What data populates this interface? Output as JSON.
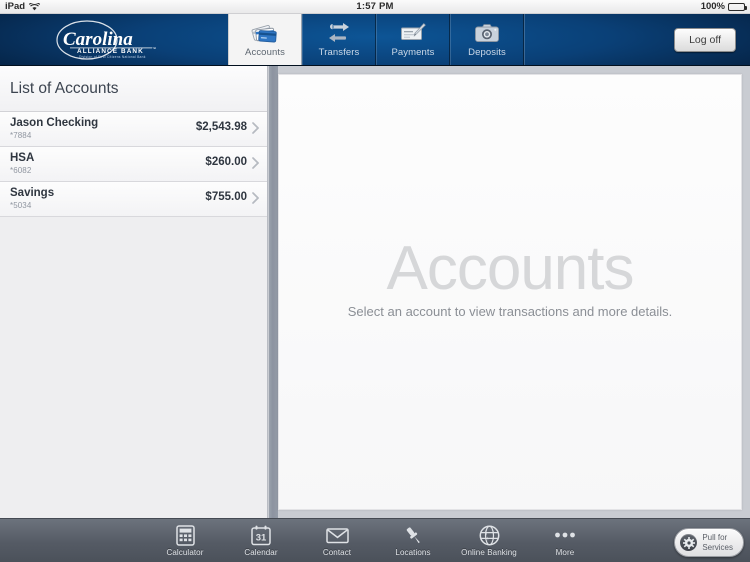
{
  "status_bar": {
    "device": "iPad",
    "wifi_icon": "wifi-icon",
    "time": "1:57 PM",
    "battery_percent": "100%",
    "battery_icon": "battery-full-icon"
  },
  "navbar": {
    "brand": {
      "name": "Carolina",
      "line2": "ALLIANCE BANK",
      "line3": "Division of First Citizens National Bank"
    },
    "tabs": [
      {
        "label": "Accounts",
        "icon": "credit-cards-icon",
        "active": true
      },
      {
        "label": "Transfers",
        "icon": "transfer-arrows-icon",
        "active": false
      },
      {
        "label": "Payments",
        "icon": "check-pen-icon",
        "active": false
      },
      {
        "label": "Deposits",
        "icon": "camera-icon",
        "active": false
      }
    ],
    "logoff_label": "Log off"
  },
  "sidebar": {
    "title": "List of Accounts",
    "accounts": [
      {
        "name": "Jason Checking",
        "number": "*7884",
        "balance": "$2,543.98"
      },
      {
        "name": "HSA",
        "number": "*6082",
        "balance": "$260.00"
      },
      {
        "name": "Savings",
        "number": "*5034",
        "balance": "$755.00"
      }
    ],
    "chevron_icon": "chevron-right-icon"
  },
  "main_panel": {
    "watermark": "Accounts",
    "subtitle": "Select an account to view transactions and more details."
  },
  "toolbar": {
    "items": [
      {
        "label": "Calculator",
        "icon": "calculator-icon"
      },
      {
        "label": "Calendar",
        "icon": "calendar-icon",
        "day": "31"
      },
      {
        "label": "Contact",
        "icon": "envelope-icon"
      },
      {
        "label": "Locations",
        "icon": "map-pin-icon"
      },
      {
        "label": "Online Banking",
        "icon": "globe-icon"
      },
      {
        "label": "More",
        "icon": "ellipsis-icon"
      }
    ],
    "services": {
      "line1": "Pull for",
      "line2": "Services",
      "icon": "gear-icon"
    }
  },
  "colors": {
    "brand_blue": "#0a4077",
    "navbar_dark": "#041a33",
    "toolbar_slate": "#555b65",
    "text_dark": "#2f3640",
    "muted": "#9096a0"
  }
}
